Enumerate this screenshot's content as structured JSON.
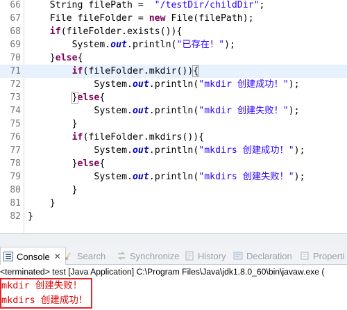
{
  "editor": {
    "lines": [
      {
        "num": "66",
        "indent": 3,
        "parts": [
          [
            "var",
            "String "
          ],
          [
            "var",
            "filePath"
          ],
          [
            "var",
            " =  "
          ],
          [
            "str",
            "\"/testDir/childDir\""
          ],
          [
            "var",
            ";"
          ]
        ]
      },
      {
        "num": "67",
        "indent": 3,
        "parts": [
          [
            "var",
            "File "
          ],
          [
            "var",
            "fileFolder"
          ],
          [
            "var",
            " = "
          ],
          [
            "kw",
            "new"
          ],
          [
            "var",
            " File("
          ],
          [
            "var",
            "filePath"
          ],
          [
            "var",
            ");"
          ]
        ]
      },
      {
        "num": "68",
        "indent": 3,
        "parts": [
          [
            "kw",
            "if"
          ],
          [
            "var",
            "("
          ],
          [
            "var",
            "fileFolder"
          ],
          [
            "var",
            ".exists()){"
          ]
        ]
      },
      {
        "num": "69",
        "indent": 4,
        "parts": [
          [
            "var",
            "System."
          ],
          [
            "fld",
            "out"
          ],
          [
            "var",
            ".println("
          ],
          [
            "str",
            "\"已存在！\""
          ],
          [
            "var",
            ");"
          ]
        ]
      },
      {
        "num": "70",
        "indent": 3,
        "parts": [
          [
            "var",
            "}"
          ],
          [
            "kw",
            "else"
          ],
          [
            "var",
            "{"
          ]
        ]
      },
      {
        "num": "71",
        "indent": 4,
        "parts": [
          [
            "kw",
            "if"
          ],
          [
            "var",
            "("
          ],
          [
            "var",
            "fileFolder"
          ],
          [
            "var",
            ".mkdir())"
          ],
          [
            "brk",
            "{"
          ]
        ],
        "current": true
      },
      {
        "num": "72",
        "indent": 5,
        "parts": [
          [
            "var",
            "System."
          ],
          [
            "fld",
            "out"
          ],
          [
            "var",
            ".println("
          ],
          [
            "str",
            "\"mkdir 创建成功！\""
          ],
          [
            "var",
            ");"
          ]
        ]
      },
      {
        "num": "73",
        "indent": 4,
        "parts": [
          [
            "brk",
            "}"
          ],
          [
            "kw",
            "else"
          ],
          [
            "var",
            "{"
          ]
        ]
      },
      {
        "num": "74",
        "indent": 5,
        "parts": [
          [
            "var",
            "System."
          ],
          [
            "fld",
            "out"
          ],
          [
            "var",
            ".println("
          ],
          [
            "str",
            "\"mkdir 创建失败！\""
          ],
          [
            "var",
            ");"
          ]
        ]
      },
      {
        "num": "75",
        "indent": 4,
        "parts": [
          [
            "var",
            "}"
          ]
        ]
      },
      {
        "num": "76",
        "indent": 4,
        "parts": [
          [
            "kw",
            "if"
          ],
          [
            "var",
            "("
          ],
          [
            "var",
            "fileFolder"
          ],
          [
            "var",
            ".mkdirs()){"
          ]
        ]
      },
      {
        "num": "77",
        "indent": 5,
        "parts": [
          [
            "var",
            "System."
          ],
          [
            "fld",
            "out"
          ],
          [
            "var",
            ".println("
          ],
          [
            "str",
            "\"mkdirs 创建成功！\""
          ],
          [
            "var",
            ");"
          ]
        ]
      },
      {
        "num": "78",
        "indent": 4,
        "parts": [
          [
            "var",
            "}"
          ],
          [
            "kw",
            "else"
          ],
          [
            "var",
            "{"
          ]
        ]
      },
      {
        "num": "79",
        "indent": 5,
        "parts": [
          [
            "var",
            "System."
          ],
          [
            "fld",
            "out"
          ],
          [
            "var",
            ".println("
          ],
          [
            "str",
            "\"mkdirs 创建失败！\""
          ],
          [
            "var",
            ");"
          ]
        ]
      },
      {
        "num": "80",
        "indent": 4,
        "parts": [
          [
            "var",
            "}"
          ]
        ]
      },
      {
        "num": "81",
        "indent": 3,
        "parts": [
          [
            "var",
            "}"
          ]
        ]
      },
      {
        "num": "82",
        "indent": 2,
        "parts": [
          [
            "var",
            "}"
          ]
        ]
      }
    ]
  },
  "tabs": {
    "console": "Console",
    "search": "Search",
    "synchronize": "Synchronize",
    "history": "History",
    "declaration": "Declaration",
    "properties": "Properti"
  },
  "status_text": "<terminated> test [Java Application] C:\\Program Files\\Java\\jdk1.8.0_60\\bin\\javaw.exe (",
  "output": [
    "mkdir 创建失败！",
    "mkdirs 创建成功！"
  ],
  "colors": {
    "keyword": "#7f0055",
    "string": "#2a00ff",
    "field": "#0000c0",
    "console_output": "#e00000",
    "highlight_box": "#e0242a"
  }
}
